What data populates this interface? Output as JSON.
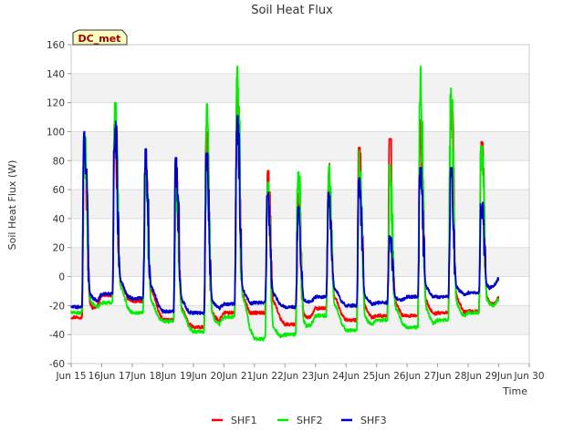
{
  "chart_data": {
    "type": "line",
    "title": "Soil Heat Flux",
    "xlabel": "Time",
    "ylabel": "Soil Heat Flux (W)",
    "badge": "DC_met",
    "ylim": [
      -60,
      160
    ],
    "yticks": [
      -60,
      -40,
      -20,
      0,
      20,
      40,
      60,
      80,
      100,
      120,
      140,
      160
    ],
    "xlim": [
      15,
      30
    ],
    "xticks": [
      {
        "x": 15,
        "label": "Jun 15"
      },
      {
        "x": 16,
        "label": "16Jun"
      },
      {
        "x": 17,
        "label": "17Jun"
      },
      {
        "x": 18,
        "label": "18Jun"
      },
      {
        "x": 19,
        "label": "19Jun"
      },
      {
        "x": 20,
        "label": "20Jun"
      },
      {
        "x": 21,
        "label": "21Jun"
      },
      {
        "x": 22,
        "label": "22Jun"
      },
      {
        "x": 23,
        "label": "23Jun"
      },
      {
        "x": 24,
        "label": "24Jun"
      },
      {
        "x": 25,
        "label": "25Jun"
      },
      {
        "x": 26,
        "label": "26Jun"
      },
      {
        "x": 27,
        "label": "27Jun"
      },
      {
        "x": 28,
        "label": "28Jun"
      },
      {
        "x": 29,
        "label": "29Jun"
      },
      {
        "x": 30,
        "label": "Jun 30"
      }
    ],
    "grid": true,
    "legend_position": "bottom",
    "day_shape_note_removed": true,
    "series": [
      {
        "name": "SHF1",
        "color": "#ff0000",
        "days": [
          15,
          16,
          17,
          18,
          19,
          20,
          21,
          22,
          23,
          24,
          25,
          26,
          27,
          28
        ],
        "peaks": [
          95,
          100,
          75,
          68,
          100,
          125,
          73,
          57,
          78,
          89,
          95,
          108,
          125,
          93
        ],
        "troughs": [
          -28,
          -13,
          -17,
          -30,
          -35,
          -25,
          -25,
          -33,
          -22,
          -30,
          -27,
          -27,
          -25,
          -24
        ]
      },
      {
        "name": "SHF2",
        "color": "#00ee00",
        "days": [
          15,
          16,
          17,
          18,
          19,
          20,
          21,
          22,
          23,
          24,
          25,
          26,
          27,
          28
        ],
        "peaks": [
          97,
          120,
          80,
          68,
          119,
          145,
          65,
          72,
          77,
          87,
          77,
          145,
          130,
          90
        ],
        "troughs": [
          -25,
          -18,
          -25,
          -31,
          -38,
          -28,
          -43,
          -40,
          -27,
          -37,
          -30,
          -35,
          -30,
          -25
        ]
      },
      {
        "name": "SHF3",
        "color": "#0000cc",
        "days": [
          15,
          16,
          17,
          18,
          19,
          20,
          21,
          22,
          23,
          24,
          25,
          26,
          27,
          28
        ],
        "peaks": [
          100,
          107,
          88,
          82,
          85,
          111,
          58,
          48,
          58,
          68,
          28,
          75,
          75,
          52
        ],
        "troughs": [
          -21,
          -12,
          -15,
          -24,
          -25,
          -19,
          -18,
          -21,
          -14,
          -20,
          -18,
          -14,
          -14,
          -11
        ]
      }
    ]
  }
}
